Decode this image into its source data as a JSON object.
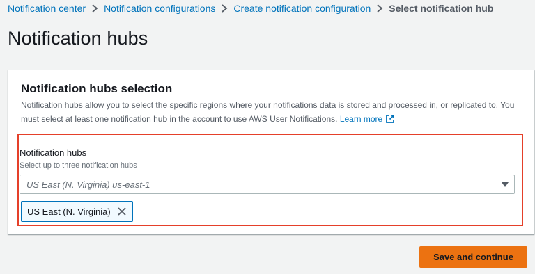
{
  "breadcrumb": {
    "items": [
      "Notification center",
      "Notification configurations",
      "Create notification configuration"
    ],
    "current": "Select notification hub"
  },
  "page": {
    "title": "Notification hubs"
  },
  "panel": {
    "title": "Notification hubs selection",
    "description": "Notification hubs allow you to select the specific regions where your notifications data is stored and processed in, or replicated to. You must select at least one notification hub in the account to use AWS User Notifications.",
    "learn_more": "Learn more"
  },
  "field": {
    "label": "Notification hubs",
    "description": "Select up to three notification hubs",
    "placeholder": "US East (N. Virginia) us-east-1"
  },
  "tokens": [
    {
      "label": "US East (N. Virginia)"
    }
  ],
  "actions": {
    "primary_label": "Save and continue"
  },
  "colors": {
    "link": "#0073bb",
    "primary": "#ec7211",
    "highlight": "#e5402a",
    "background": "#f2f3f3"
  },
  "icons": {
    "breadcrumb_separator": "chevron-right-icon",
    "external_link": "external-link-icon",
    "dropdown": "caret-down-icon",
    "dismiss": "close-icon"
  }
}
